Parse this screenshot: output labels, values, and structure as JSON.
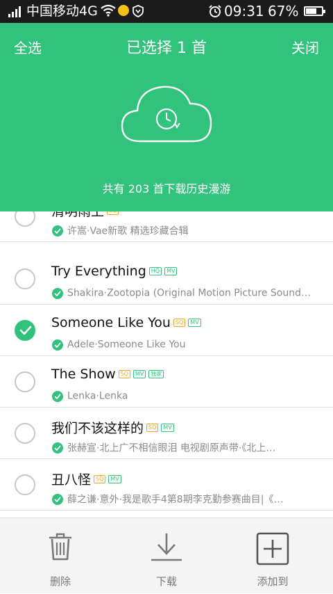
{
  "status_bar": {
    "carrier": "中国移动4G",
    "time": "09:31",
    "battery": "67%",
    "battery_level": 0.67
  },
  "header": {
    "select_all": "全选",
    "title": "已选择 1 首",
    "close": "关闭",
    "history_info": "共有 203 首下载历史漫游"
  },
  "songs": [
    {
      "title": "清明雨上",
      "badges": [
        "SQ"
      ],
      "subtitle": "许嵩·Vae新歌 精选珍藏合辑",
      "selected": false
    },
    {
      "title": "Try Everything",
      "badges": [
        "HQ",
        "MV"
      ],
      "subtitle": "Shakira·Zootopia (Original Motion Picture Sound…",
      "selected": false
    },
    {
      "title": "Someone Like You",
      "badges": [
        "SQ",
        "MV"
      ],
      "subtitle": "Adele·Someone Like You",
      "selected": true
    },
    {
      "title": "The Show",
      "badges": [
        "SQ",
        "MV",
        "独家"
      ],
      "subtitle": "Lenka·Lenka",
      "selected": false
    },
    {
      "title": "我们不该这样的",
      "badges": [
        "SQ",
        "MV"
      ],
      "subtitle": "张赫宣·北上广不相信眼泪 电视剧原声带·《北上…",
      "selected": false
    },
    {
      "title": "丑八怪",
      "badges": [
        "SQ",
        "MV"
      ],
      "subtitle": "薛之谦·意外·我是歌手4第8期李克勤参赛曲目|《…",
      "selected": false
    }
  ],
  "bottom_bar": {
    "delete": "删除",
    "download": "下载",
    "add_to": "添加到"
  },
  "colors": {
    "accent": "#31c27c",
    "badge_sq": "#f5a623",
    "status_bar": "#1b1b1b"
  },
  "icons": [
    "signal-icon",
    "wifi-icon",
    "qq-icon",
    "shield-icon",
    "alarm-icon",
    "battery-icon",
    "cloud-history-icon",
    "check-icon",
    "trash-icon",
    "download-icon",
    "add-icon"
  ]
}
